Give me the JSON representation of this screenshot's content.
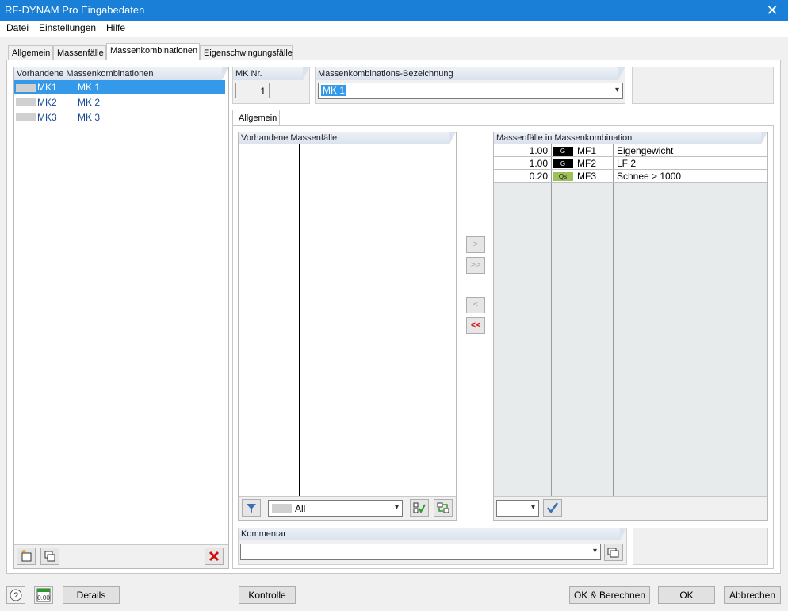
{
  "window": {
    "title": "RF-DYNAM Pro Eingabedaten",
    "close": "✕"
  },
  "menu": [
    "Datei",
    "Einstellungen",
    "Hilfe"
  ],
  "tabs": [
    "Allgemein",
    "Massenfälle",
    "Massenkombinationen",
    "Eigenschwingungsfälle"
  ],
  "left": {
    "header": "Vorhandene Massenkombinationen",
    "items": [
      {
        "id": "MK1",
        "name": "MK 1"
      },
      {
        "id": "MK2",
        "name": "MK 2"
      },
      {
        "id": "MK3",
        "name": "MK 3"
      }
    ]
  },
  "mk": {
    "nr_label": "MK Nr.",
    "nr_value": "1",
    "bez_label": "Massenkombinations-Bezeichnung",
    "bez_value": "MK 1"
  },
  "subtab": "Allgemein",
  "available": {
    "header": "Vorhandene Massenfälle",
    "filter_value": "All"
  },
  "incombo": {
    "header": "Massenfälle in Massenkombination",
    "rows": [
      {
        "factor": "1.00",
        "badge": "G",
        "id": "MF1",
        "name": "Eigengewicht"
      },
      {
        "factor": "1.00",
        "badge": "G",
        "id": "MF2",
        "name": "LF 2"
      },
      {
        "factor": "0.20",
        "badge": "Qs",
        "id": "MF3",
        "name": "Schnee > 1000"
      }
    ]
  },
  "comment": {
    "label": "Kommentar",
    "value": ""
  },
  "footer": {
    "details": "Details",
    "kontrolle": "Kontrolle",
    "ok_calc": "OK & Berechnen",
    "ok": "OK",
    "cancel": "Abbrechen"
  }
}
